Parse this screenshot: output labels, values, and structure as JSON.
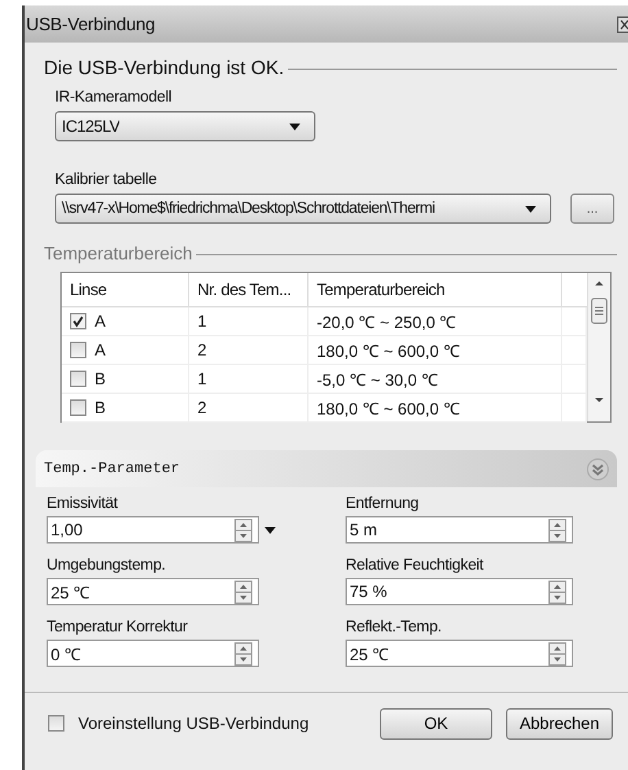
{
  "window": {
    "title": "USB-Verbindung"
  },
  "status": "Die USB-Verbindung ist OK.",
  "camera_model": {
    "label": "IR-Kameramodell",
    "value": "IC125LV"
  },
  "calibration_table": {
    "label": "Kalibrier tabelle",
    "value": "\\\\srv47-x\\Home$\\friedrichma\\Desktop\\Schrottdateien\\Thermi",
    "browse_button": "..."
  },
  "temperature_range": {
    "title": "Temperaturbereich",
    "table": {
      "columns": [
        "Linse",
        "Nr. des Tem...",
        "Temperaturbereich"
      ],
      "rows": [
        {
          "lens": "A",
          "number": "1",
          "range": "-20,0 ℃ ~ 250,0 ℃",
          "checked": true
        },
        {
          "lens": "A",
          "number": "2",
          "range": "180,0 ℃ ~ 600,0 ℃",
          "checked": false
        },
        {
          "lens": "B",
          "number": "1",
          "range": "-5,0 ℃ ~ 30,0 ℃",
          "checked": false
        },
        {
          "lens": "B",
          "number": "2",
          "range": "180,0 ℃ ~ 600,0 ℃",
          "checked": false
        }
      ]
    }
  },
  "temp_parameters": {
    "title": "Temp.-Parameter",
    "expanded": true,
    "fields": [
      {
        "label": "Emissivität",
        "value": "1,00",
        "kind": "spin-dropdown"
      },
      {
        "label": "Entfernung",
        "value": "5 m",
        "kind": "spin"
      },
      {
        "label": "Umgebungstemp.",
        "value": "25 ℃",
        "kind": "spin"
      },
      {
        "label": "Relative Feuchtigkeit",
        "value": "75 %",
        "kind": "spin"
      },
      {
        "label": "Temperatur Korrektur",
        "value": "0 ℃",
        "kind": "spin"
      },
      {
        "label": "Reflekt.-Temp.",
        "value": "25 ℃",
        "kind": "spin"
      }
    ]
  },
  "footer": {
    "default_checkbox": {
      "label": "Voreinstellung USB-Verbindung",
      "checked": false
    },
    "buttons": [
      "OK",
      "Abbrechen"
    ]
  }
}
